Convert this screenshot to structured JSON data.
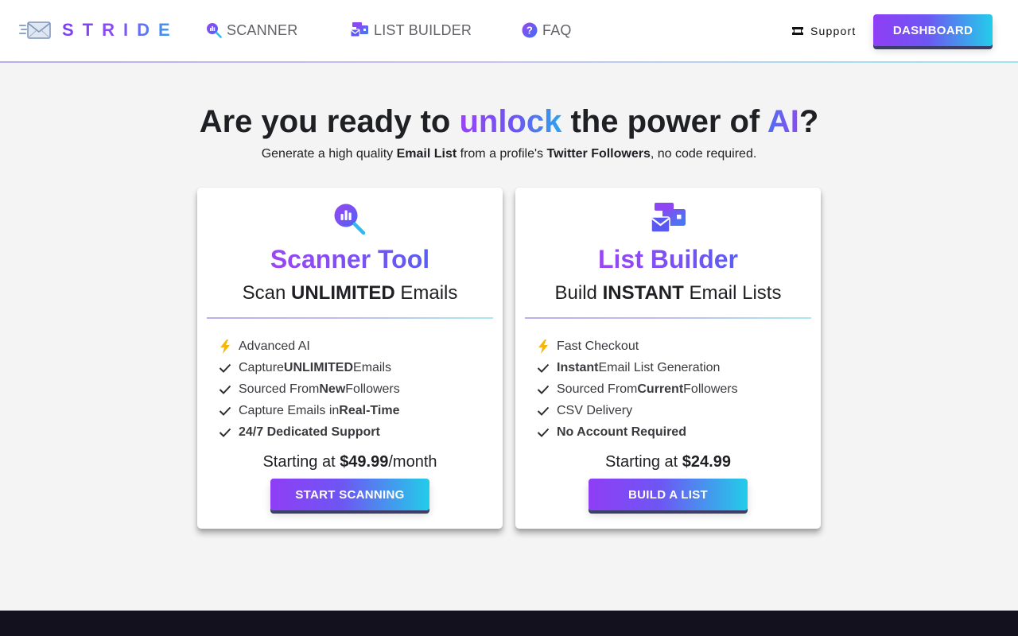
{
  "brand": {
    "name": "STRIDE",
    "icon": "envelope-speed-icon"
  },
  "nav": {
    "items": [
      {
        "label": "SCANNER",
        "icon": "magnifier-chart-icon"
      },
      {
        "label": "LIST BUILDER",
        "icon": "stacked-mail-icon"
      },
      {
        "label": "FAQ",
        "icon": "question-circle-icon"
      }
    ],
    "support_label": "Support",
    "support_icon": "ticket-icon",
    "dashboard_label": "DASHBOARD"
  },
  "hero": {
    "title_part1": "Are you ready to ",
    "title_highlight1": "unlock",
    "title_part2": " the power of ",
    "title_highlight2": "AI",
    "title_part3": "?",
    "sub_part1": "Generate a high quality ",
    "sub_bold1": "Email List",
    "sub_part2": " from a profile's ",
    "sub_bold2": "Twitter Followers",
    "sub_part3": ", no code required."
  },
  "cards": [
    {
      "title": "Scanner Tool",
      "subtitle_pre": "Scan ",
      "subtitle_bold": "UNLIMITED",
      "subtitle_post": " Emails",
      "features": [
        {
          "icon": "lightning-icon",
          "pre": "Advanced AI",
          "bold": "",
          "post": ""
        },
        {
          "icon": "check-icon",
          "pre": "Capture ",
          "bold": "UNLIMITED",
          "post": " Emails"
        },
        {
          "icon": "check-icon",
          "pre": "Sourced From ",
          "bold": "New",
          "post": " Followers"
        },
        {
          "icon": "check-icon",
          "pre": "Capture Emails in ",
          "bold": "Real-Time",
          "post": ""
        },
        {
          "icon": "check-icon",
          "pre": "",
          "bold": "24/7 Dedicated Support",
          "post": ""
        }
      ],
      "price_pre": "Starting at ",
      "price_bold": "$49.99",
      "price_post": "/month",
      "button": "START SCANNING"
    },
    {
      "title": "List Builder",
      "subtitle_pre": "Build ",
      "subtitle_bold": "INSTANT",
      "subtitle_post": " Email Lists",
      "features": [
        {
          "icon": "lightning-icon",
          "pre": "Fast Checkout",
          "bold": "",
          "post": ""
        },
        {
          "icon": "check-icon",
          "pre": "",
          "bold": "Instant",
          "post": " Email List Generation"
        },
        {
          "icon": "check-icon",
          "pre": "Sourced From ",
          "bold": "Current",
          "post": " Followers"
        },
        {
          "icon": "check-icon",
          "pre": "CSV Delivery",
          "bold": "",
          "post": ""
        },
        {
          "icon": "check-icon",
          "pre": "",
          "bold": "No Account Required",
          "post": ""
        }
      ],
      "price_pre": "Starting at ",
      "price_bold": "$24.99",
      "price_post": "",
      "button": "BUILD A LIST"
    }
  ],
  "colors": {
    "accent_purple": "#8f3ef5",
    "accent_cyan": "#22cde9",
    "background": "#f4f4f5",
    "footer": "#13111d",
    "lightning": "#f5b50a"
  }
}
